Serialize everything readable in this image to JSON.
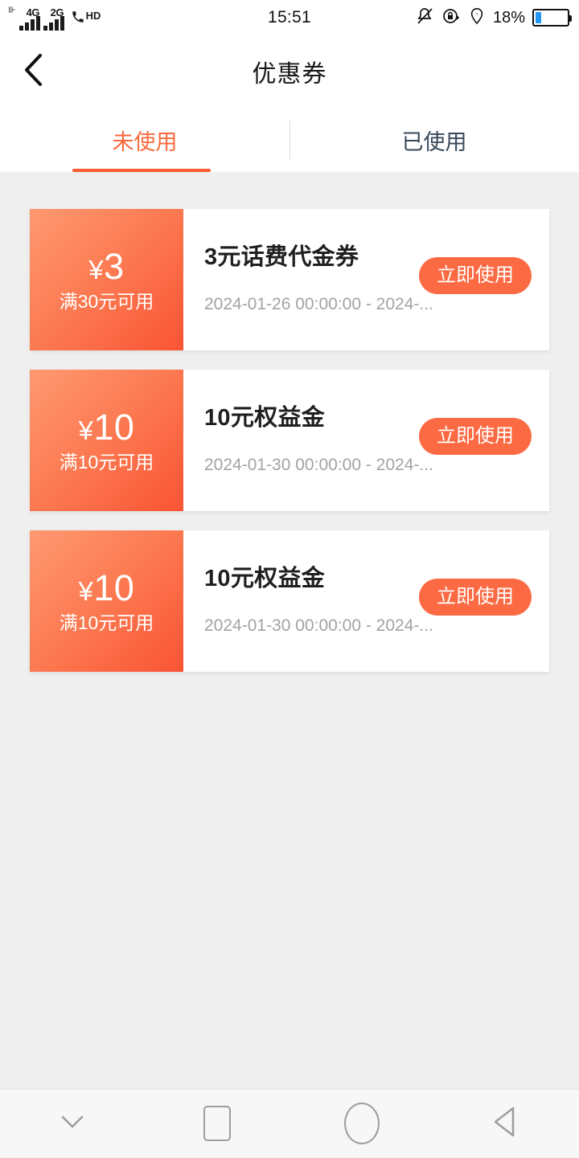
{
  "status_bar": {
    "signal_1_label": "4G",
    "signal_2_label": "2G",
    "call_label": "HD",
    "time": "15:51",
    "battery_percent": "18%",
    "battery_level": 18,
    "icons": [
      "mute-bell-icon",
      "rotation-lock-icon",
      "location-pin-icon"
    ]
  },
  "header": {
    "back_icon": "chevron-left-icon",
    "title": "优惠券"
  },
  "tabs": [
    {
      "label": "未使用",
      "active": true
    },
    {
      "label": "已使用",
      "active": false
    }
  ],
  "coupons": [
    {
      "currency": "¥",
      "amount": "3",
      "threshold": "满30元可用",
      "title": "3元话费代金券",
      "date_range": "2024-01-26 00:00:00 - 2024-...",
      "action_label": "立即使用"
    },
    {
      "currency": "¥",
      "amount": "10",
      "threshold": "满10元可用",
      "title": "10元权益金",
      "date_range": "2024-01-30 00:00:00 - 2024-...",
      "action_label": "立即使用"
    },
    {
      "currency": "¥",
      "amount": "10",
      "threshold": "满10元可用",
      "title": "10元权益金",
      "date_range": "2024-01-30 00:00:00 - 2024-...",
      "action_label": "立即使用"
    }
  ],
  "navbar": [
    {
      "icon": "chevron-down-icon"
    },
    {
      "icon": "square-recents-icon"
    },
    {
      "icon": "circle-home-icon"
    },
    {
      "icon": "triangle-back-icon"
    }
  ],
  "colors": {
    "accent": "#F96A3E",
    "button": "#FC6A43",
    "tab_underline": "#F85A32",
    "gradient_start": "#FF9971",
    "gradient_end": "#FA5433",
    "page_background": "#EFEFEF",
    "battery_fill": "#2196F3"
  }
}
